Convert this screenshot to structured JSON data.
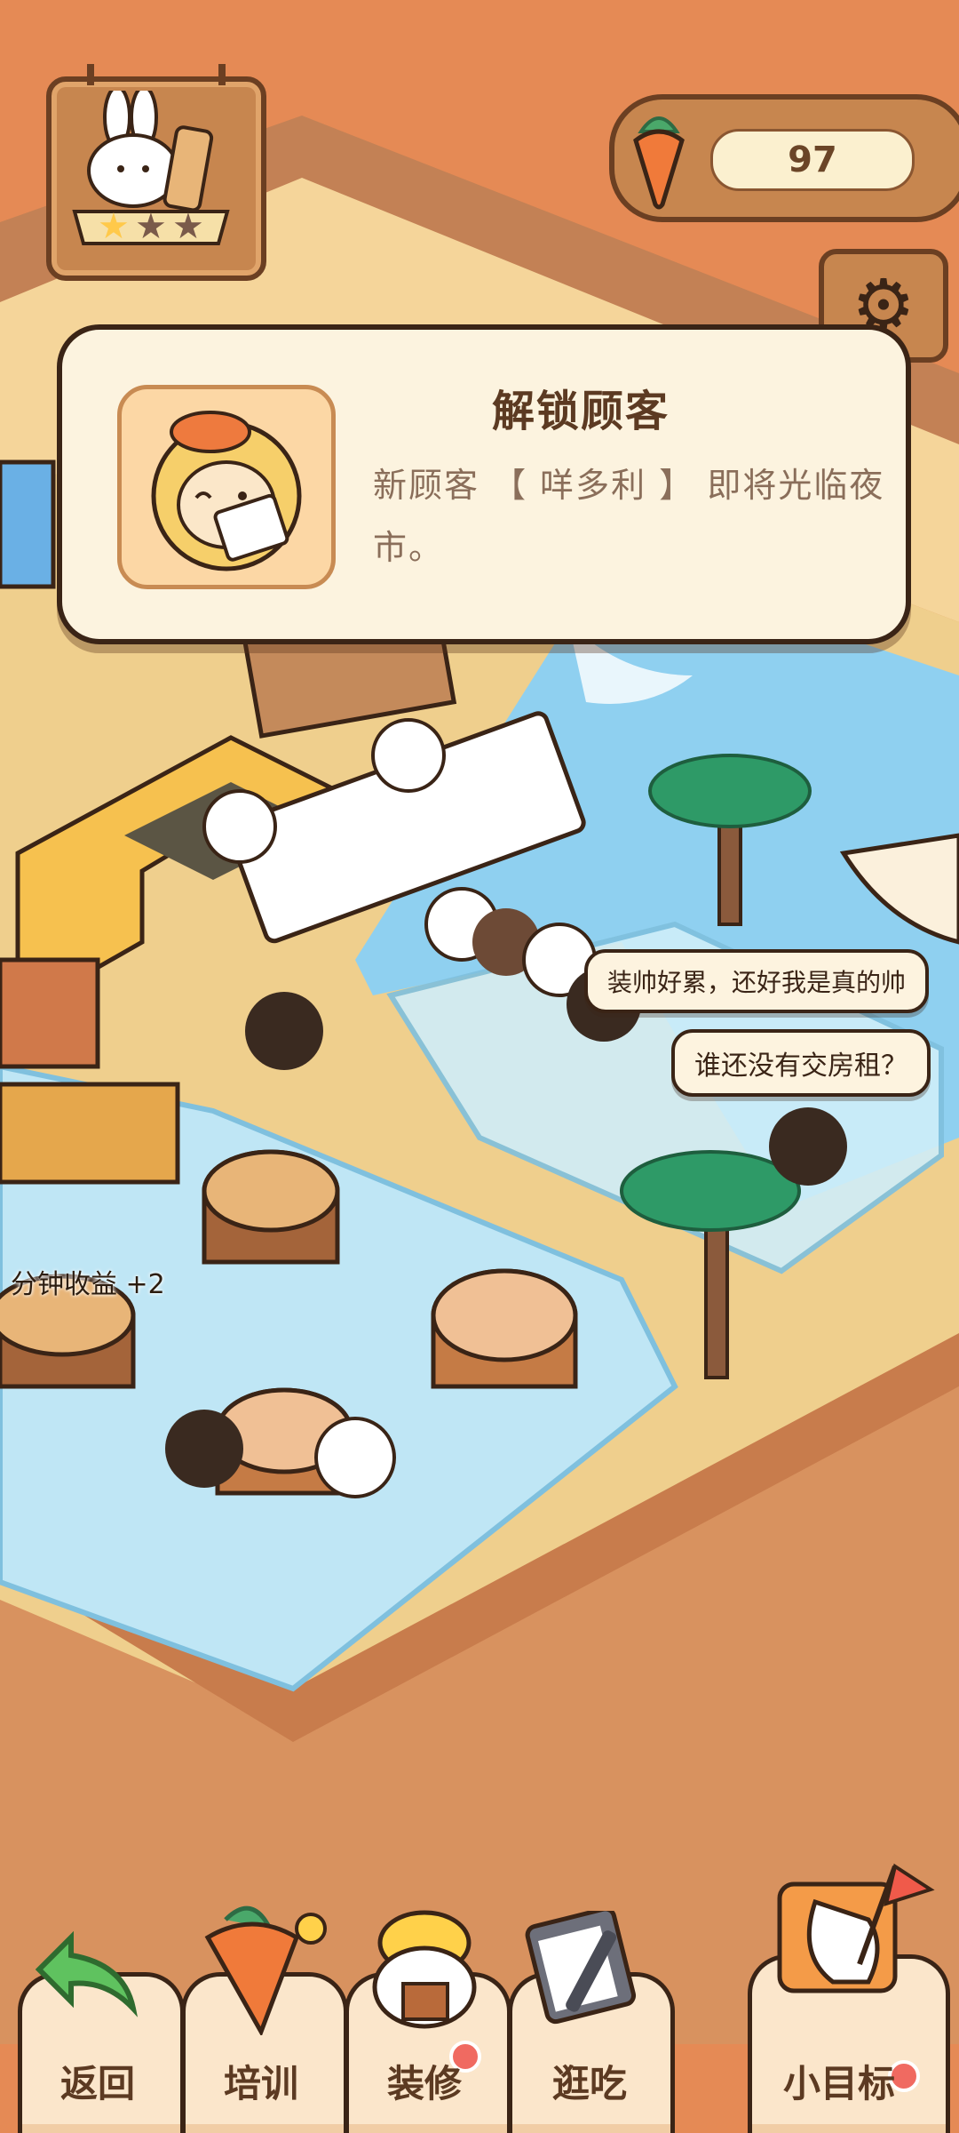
{
  "hud": {
    "carrots": "97",
    "level_stars": 3,
    "level_stars_lit": 1
  },
  "dialog": {
    "title": "解锁顾客",
    "body": "新顾客 【 咩多利 】 即将光临夜市。"
  },
  "bubbles": [
    {
      "text": "装帅好累，还好我是真的帅"
    },
    {
      "text": "谁还没有交房租？"
    }
  ],
  "earnings": {
    "text": "分钟收益 +2"
  },
  "bottom_bar": {
    "back": "返回",
    "train": "培训",
    "decorate": "装修",
    "browse": "逛吃",
    "goal": "小目标"
  },
  "colors": {
    "background": "#e58a55",
    "wood": "#c7864f",
    "wood_dark": "#6b3f22",
    "cream": "#fcf3df",
    "water": "#8fd0f0",
    "sand": "#e9c07d",
    "notification": "#f06a61"
  }
}
